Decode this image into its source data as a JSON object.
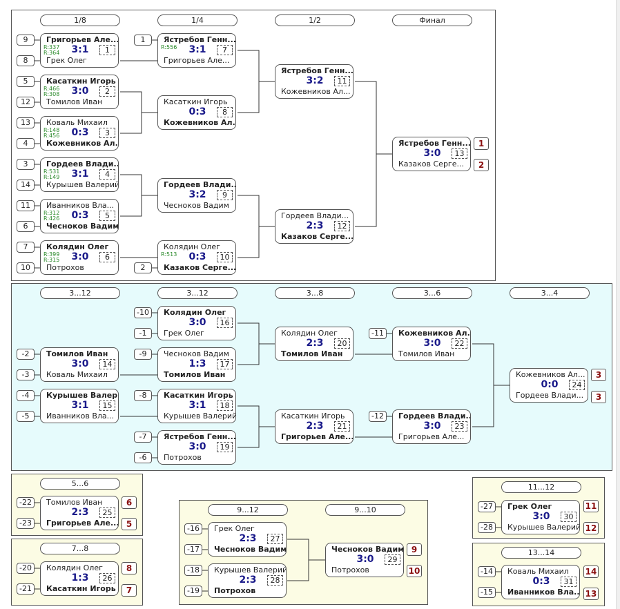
{
  "headers": {
    "main": [
      "1/8",
      "1/4",
      "1/2",
      "Финал"
    ],
    "places3": [
      "3...12",
      "3...12",
      "3...8",
      "3...6",
      "3...4"
    ],
    "p56": "5...6",
    "p78": "7...8",
    "p912": "9...12",
    "p910": "9...10",
    "p1112": "11...12",
    "p1314": "13...14"
  },
  "seeds": [
    "9",
    "8",
    "5",
    "12",
    "13",
    "4",
    "3",
    "14",
    "11",
    "6",
    "7",
    "10",
    "1",
    "2",
    "-10",
    "-1",
    "-9",
    "-2",
    "-3",
    "-4",
    "-5",
    "-8",
    "-7",
    "-6",
    "-11",
    "-12",
    "-22",
    "-23",
    "-20",
    "-21",
    "-16",
    "-17",
    "-18",
    "-19",
    "-27",
    "-28",
    "-14",
    "-15"
  ],
  "matches": [
    {
      "n": "1",
      "p1": "Григорьев Але...",
      "p2": "Грек Олег",
      "score": "3:1",
      "w": 1,
      "r1": "R:337",
      "r2": "R:364"
    },
    {
      "n": "2",
      "p1": "Касаткин Игорь",
      "p2": "Томилов Иван",
      "score": "3:0",
      "w": 1,
      "r1": "R:466",
      "r2": "R:308"
    },
    {
      "n": "3",
      "p1": "Коваль Михаил",
      "p2": "Кожевников Ал...",
      "score": "0:3",
      "w": 2,
      "r1": "R:148",
      "r2": "R:456"
    },
    {
      "n": "4",
      "p1": "Гордеев Влади...",
      "p2": "Курышев Валерий",
      "score": "3:1",
      "w": 1,
      "r1": "R:531",
      "r2": "R:149"
    },
    {
      "n": "5",
      "p1": "Иванников Вла...",
      "p2": "Чесноков Вадим",
      "score": "0:3",
      "w": 2,
      "r1": "R:312",
      "r2": "R:426"
    },
    {
      "n": "6",
      "p1": "Колядин Олег",
      "p2": "Потрохов",
      "score": "3:0",
      "w": 1,
      "r1": "R:399",
      "r2": "R:315"
    },
    {
      "n": "7",
      "p1": "Ястребов Генн...",
      "p2": "Григорьев Але...",
      "score": "3:1",
      "w": 1,
      "r1": "R:556",
      "r2": ""
    },
    {
      "n": "8",
      "p1": "Касаткин Игорь",
      "p2": "Кожевников Ал...",
      "score": "0:3",
      "w": 2,
      "r1": "",
      "r2": ""
    },
    {
      "n": "9",
      "p1": "Гордеев Влади...",
      "p2": "Чесноков Вадим",
      "score": "3:2",
      "w": 1,
      "r1": "",
      "r2": ""
    },
    {
      "n": "10",
      "p1": "Колядин Олег",
      "p2": "Казаков Серге...",
      "score": "0:3",
      "w": 2,
      "r1": "R:513",
      "r2": ""
    },
    {
      "n": "11",
      "p1": "Ястребов Генн...",
      "p2": "Кожевников Ал...",
      "score": "3:2",
      "w": 1,
      "r1": "",
      "r2": ""
    },
    {
      "n": "12",
      "p1": "Гордеев Влади...",
      "p2": "Казаков Серге...",
      "score": "2:3",
      "w": 2,
      "r1": "",
      "r2": ""
    },
    {
      "n": "13",
      "p1": "Ястребов Генн...",
      "p2": "Казаков Серге...",
      "score": "3:0",
      "w": 1,
      "r1": "",
      "r2": ""
    },
    {
      "n": "14",
      "p1": "Томилов Иван",
      "p2": "Коваль Михаил",
      "score": "3:0",
      "w": 1,
      "r1": "",
      "r2": ""
    },
    {
      "n": "15",
      "p1": "Курышев Валерий",
      "p2": "Иванников Вла...",
      "score": "3:1",
      "w": 1,
      "r1": "",
      "r2": ""
    },
    {
      "n": "16",
      "p1": "Колядин Олег",
      "p2": "Грек Олег",
      "score": "3:0",
      "w": 1,
      "r1": "",
      "r2": ""
    },
    {
      "n": "17",
      "p1": "Чесноков Вадим",
      "p2": "Томилов Иван",
      "score": "1:3",
      "w": 2,
      "r1": "",
      "r2": ""
    },
    {
      "n": "18",
      "p1": "Касаткин Игорь",
      "p2": "Курышев Валерий",
      "score": "3:1",
      "w": 1,
      "r1": "",
      "r2": ""
    },
    {
      "n": "19",
      "p1": "Ястребов Генн...",
      "p2": "Потрохов",
      "score": "3:0",
      "w": 1,
      "r1": "",
      "r2": ""
    },
    {
      "n": "20",
      "p1": "Колядин Олег",
      "p2": "Томилов Иван",
      "score": "2:3",
      "w": 2,
      "r1": "",
      "r2": ""
    },
    {
      "n": "21",
      "p1": "Касаткин Игорь",
      "p2": "Григорьев Але...",
      "score": "2:3",
      "w": 2,
      "r1": "",
      "r2": ""
    },
    {
      "n": "22",
      "p1": "Кожевников Ал...",
      "p2": "Томилов Иван",
      "score": "3:0",
      "w": 1,
      "r1": "",
      "r2": ""
    },
    {
      "n": "23",
      "p1": "Гордеев Влади...",
      "p2": "Григорьев Але...",
      "score": "3:0",
      "w": 1,
      "r1": "",
      "r2": ""
    },
    {
      "n": "24",
      "p1": "Кожевников Ал...",
      "p2": "Гордеев Влади...",
      "score": "0:0",
      "w": 0,
      "r1": "",
      "r2": ""
    },
    {
      "n": "25",
      "p1": "Томилов Иван",
      "p2": "Григорьев Але...",
      "score": "2:3",
      "w": 2,
      "r1": "",
      "r2": ""
    },
    {
      "n": "26",
      "p1": "Колядин Олег",
      "p2": "Касаткин Игорь",
      "score": "1:3",
      "w": 2,
      "r1": "",
      "r2": ""
    },
    {
      "n": "27",
      "p1": "Грек Олег",
      "p2": "Чесноков Вадим",
      "score": "2:3",
      "w": 2,
      "r1": "",
      "r2": ""
    },
    {
      "n": "28",
      "p1": "Курышев Валерий",
      "p2": "Потрохов",
      "score": "2:3",
      "w": 2,
      "r1": "",
      "r2": ""
    },
    {
      "n": "29",
      "p1": "Чесноков Вадим",
      "p2": "Потрохов",
      "score": "3:0",
      "w": 1,
      "r1": "",
      "r2": ""
    },
    {
      "n": "30",
      "p1": "Грек Олег",
      "p2": "Курышев Валерий",
      "score": "3:0",
      "w": 1,
      "r1": "",
      "r2": ""
    },
    {
      "n": "31",
      "p1": "Коваль Михаил",
      "p2": "Иванников Вла...",
      "score": "0:3",
      "w": 2,
      "r1": "",
      "r2": ""
    }
  ],
  "ranks": [
    "1",
    "2",
    "3",
    "3",
    "6",
    "5",
    "8",
    "7",
    "9",
    "10",
    "11",
    "12",
    "14",
    "13"
  ],
  "colors": {
    "panel_blue": "#e6fbfc",
    "panel_yellow": "#fcfce4",
    "score": "#1a1a8a",
    "rank": "#8b1010",
    "rating": "#2a8a2a"
  }
}
